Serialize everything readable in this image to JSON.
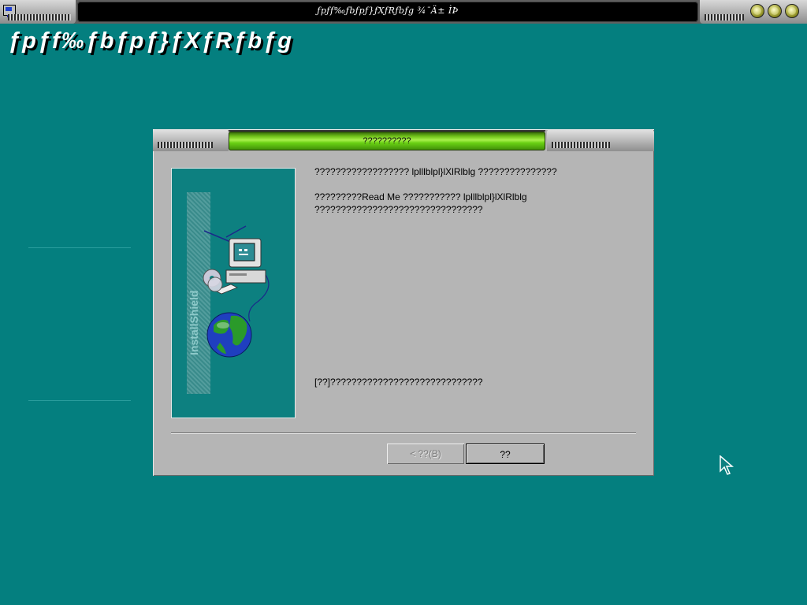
{
  "window": {
    "title": "ƒpƒf‰ƒbƒpƒ}ƒXƒRƒbƒg ¾¯Ä± ÌÞ",
    "controls": [
      "minimize-button",
      "maximize-button",
      "close-button"
    ]
  },
  "banner": {
    "text": "ƒpƒf‰ƒbƒpƒ}ƒXƒRƒbƒg"
  },
  "dialog": {
    "title": "??????????",
    "message_1": "?????????????????? lplllblpl}lXlRlblg ???????????????",
    "message_2_line1": "?????????Read Me ??????????? lplllblpl}lXlRlblg",
    "message_2_line2": "????????????????????????????????",
    "message_3": "[??]?????????????????????????????",
    "side_image_text": "InstallShield",
    "buttons": {
      "back": "< ??(B)",
      "next": "??"
    }
  },
  "colors": {
    "desktop": "#047f7f",
    "dialog": "#b5b5b5",
    "title_green": "#6fc21a"
  }
}
